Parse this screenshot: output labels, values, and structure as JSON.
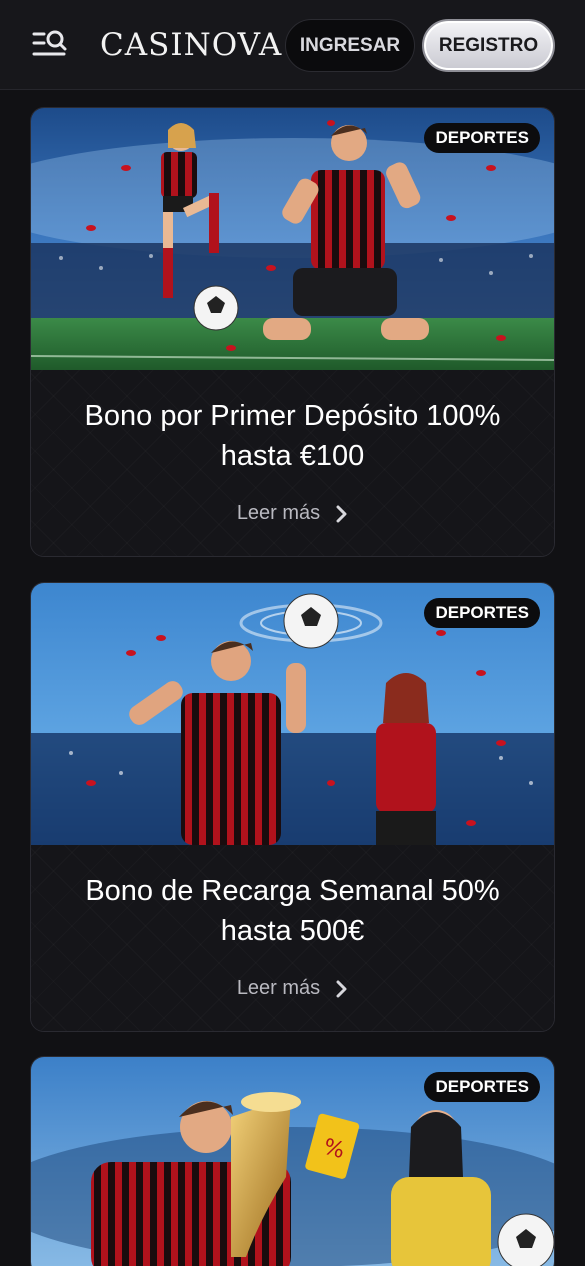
{
  "header": {
    "logo_text": "CASINOVA",
    "login_label": "INGRESAR",
    "register_label": "REGISTRO"
  },
  "cards": [
    {
      "badge": "DEPORTES",
      "title": "Bono por Primer Depósito 100% hasta €100",
      "read_more": "Leer más",
      "image": "footballers-celebrating-stadium"
    },
    {
      "badge": "DEPORTES",
      "title": "Bono de Recarga Semanal 50% hasta 500€",
      "read_more": "Leer más",
      "image": "player-spinning-ball-stadium"
    },
    {
      "badge": "DEPORTES",
      "title": "",
      "read_more": "",
      "image": "player-trophy-referee-card"
    }
  ],
  "colors": {
    "background": "#111114",
    "jersey_red": "#b1121c",
    "badge_bg": "#0c0c0e"
  }
}
